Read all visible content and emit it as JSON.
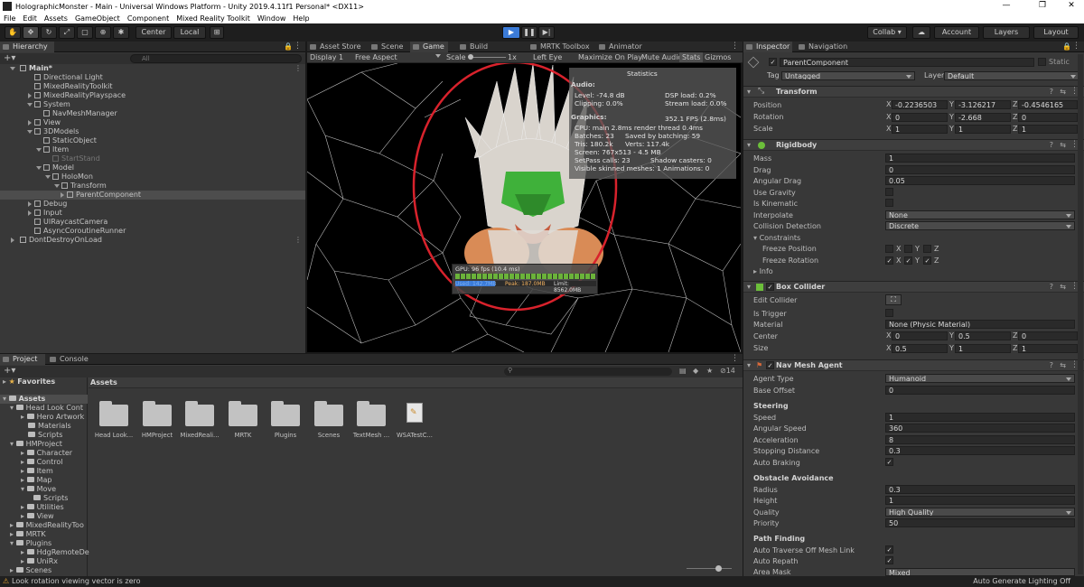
{
  "window": {
    "title": "HolographicMonster - Main - Universal Windows Platform - Unity 2019.4.11f1 Personal* <DX11>",
    "controls": [
      "—",
      "❐",
      "✕"
    ]
  },
  "menu": [
    "File",
    "Edit",
    "Assets",
    "GameObject",
    "Component",
    "Mixed Reality Toolkit",
    "Window",
    "Help"
  ],
  "toolbar": {
    "center": "Center",
    "local": "Local",
    "collab": "Collab ▾",
    "account": "Account",
    "layers": "Layers",
    "layout": "Layout"
  },
  "hierarchy": {
    "tab": "Hierarchy",
    "search_placeholder": "All",
    "items": [
      {
        "label": "Main*"
      },
      {
        "label": "Directional Light"
      },
      {
        "label": "MixedRealityToolkit"
      },
      {
        "label": "MixedRealityPlayspace"
      },
      {
        "label": "System"
      },
      {
        "label": "NavMeshManager"
      },
      {
        "label": "View"
      },
      {
        "label": "3DModels"
      },
      {
        "label": "StaticObject"
      },
      {
        "label": "Item"
      },
      {
        "label": "StartStand"
      },
      {
        "label": "Model"
      },
      {
        "label": "HoloMon"
      },
      {
        "label": "Transform"
      },
      {
        "label": "ParentComponent"
      },
      {
        "label": "Debug"
      },
      {
        "label": "Input"
      },
      {
        "label": "UIRaycastCamera"
      },
      {
        "label": "AsyncCoroutineRunner"
      },
      {
        "label": "DontDestroyOnLoad"
      }
    ]
  },
  "center_tabs": {
    "asset_store": "Asset Store",
    "scene": "Scene",
    "game": "Game",
    "build": "Build Window",
    "mrtk": "MRTK Toolbox",
    "animator": "Animator"
  },
  "game_bar": {
    "display": "Display 1",
    "aspect": "Free Aspect",
    "scale": "Scale",
    "scale_val": "1x",
    "eye": "Left Eye",
    "maximize": "Maximize On Play",
    "mute": "Mute Audio",
    "stats": "Stats",
    "gizmos": "Gizmos"
  },
  "stats": {
    "title": "Statistics",
    "audio": "Audio:",
    "level": "Level: -74.8 dB",
    "dsp": "DSP load: 0.2%",
    "clipping": "Clipping: 0.0%",
    "stream": "Stream load: 0.0%",
    "graphics": "Graphics:",
    "fps": "352.1 FPS (2.8ms)",
    "cpu": "CPU: main 2.8ms  render thread 0.4ms",
    "batches": "Batches: 23",
    "saved": "Saved by batching: 59",
    "tris": "Tris: 180.2k",
    "verts": "Verts: 117.4k",
    "screen": "Screen: 767x513 - 4.5 MB",
    "setpass": "SetPass calls: 23",
    "shadow": "Shadow casters: 0",
    "skinned": "Visible skinned meshes: 1  Animations: 0"
  },
  "profiler": {
    "gpu": "GPU: 96 fps (10.4 ms)",
    "used": "Used: 142.7MB",
    "peak": "Peak: 187.0MB",
    "limit": "Limit: 8562.0MB"
  },
  "inspector": {
    "tab": "Inspector",
    "nav_tab": "Navigation",
    "name": "ParentComponent",
    "static": "Static",
    "tag_label": "Tag",
    "tag": "Untagged",
    "layer_label": "Layer",
    "layer": "Default",
    "transform": {
      "title": "Transform",
      "position": "Position",
      "rotation": "Rotation",
      "scale": "Scale",
      "pos": [
        "-0.2236503",
        "-3.126217",
        "-0.4546165"
      ],
      "rot": [
        "0",
        "-2.668",
        "0"
      ],
      "scl": [
        "1",
        "1",
        "1"
      ]
    },
    "rigidbody": {
      "title": "Rigidbody",
      "mass": "Mass",
      "mass_v": "1",
      "drag": "Drag",
      "drag_v": "0",
      "adrag": "Angular Drag",
      "adrag_v": "0.05",
      "gravity": "Use Gravity",
      "kinematic": "Is Kinematic",
      "interp": "Interpolate",
      "interp_v": "None",
      "coll": "Collision Detection",
      "coll_v": "Discrete",
      "constraints": "Constraints",
      "fpos": "Freeze Position",
      "frot": "Freeze Rotation",
      "info": "Info"
    },
    "boxcollider": {
      "title": "Box Collider",
      "edit": "Edit Collider",
      "trigger": "Is Trigger",
      "material": "Material",
      "material_v": "None (Physic Material)",
      "center": "Center",
      "c": [
        "0",
        "0.5",
        "0"
      ],
      "size": "Size",
      "s": [
        "0.5",
        "1",
        "1"
      ]
    },
    "navmesh": {
      "title": "Nav Mesh Agent",
      "agent_type": "Agent Type",
      "agent_type_v": "Humanoid",
      "base_offset": "Base Offset",
      "base_offset_v": "0",
      "steering": "Steering",
      "speed": "Speed",
      "speed_v": "1",
      "aspeed": "Angular Speed",
      "aspeed_v": "360",
      "accel": "Acceleration",
      "accel_v": "8",
      "stop": "Stopping Distance",
      "stop_v": "0.3",
      "autobrake": "Auto Braking",
      "obstacle": "Obstacle Avoidance",
      "radius": "Radius",
      "radius_v": "0.3",
      "height": "Height",
      "height_v": "1",
      "quality": "Quality",
      "quality_v": "High Quality",
      "priority": "Priority",
      "priority_v": "50",
      "pathfinding": "Path Finding",
      "traverse": "Auto Traverse Off Mesh Link",
      "repath": "Auto Repath",
      "area": "Area Mask",
      "area_v": "Mixed"
    }
  },
  "project": {
    "tab": "Project",
    "console_tab": "Console",
    "assets_header": "Assets",
    "count": "14",
    "favorites": "Favorites",
    "tree": [
      {
        "label": "Assets"
      },
      {
        "label": "Head Look Cont"
      },
      {
        "label": "Hero Artwork"
      },
      {
        "label": "Materials"
      },
      {
        "label": "Scripts"
      },
      {
        "label": "HMProject"
      },
      {
        "label": "Character"
      },
      {
        "label": "Control"
      },
      {
        "label": "Item"
      },
      {
        "label": "Map"
      },
      {
        "label": "Move"
      },
      {
        "label": "Scripts"
      },
      {
        "label": "Utilities"
      },
      {
        "label": "View"
      },
      {
        "label": "MixedRealityToo"
      },
      {
        "label": "MRTK"
      },
      {
        "label": "Plugins"
      },
      {
        "label": "HdgRemoteDe"
      },
      {
        "label": "UniRx"
      },
      {
        "label": "Scenes"
      }
    ],
    "folders": [
      {
        "label": "Head Look..."
      },
      {
        "label": "HMProject"
      },
      {
        "label": "MixedReali..."
      },
      {
        "label": "MRTK"
      },
      {
        "label": "Plugins"
      },
      {
        "label": "Scenes"
      },
      {
        "label": "TextMesh ..."
      },
      {
        "label": "WSATestC..."
      }
    ]
  },
  "status": {
    "message": "Look rotation viewing vector is zero",
    "right": "Auto Generate Lighting Off"
  },
  "colors": {
    "accent": "#3b7bd8",
    "circle": "#d8222c",
    "panel": "#383838"
  }
}
